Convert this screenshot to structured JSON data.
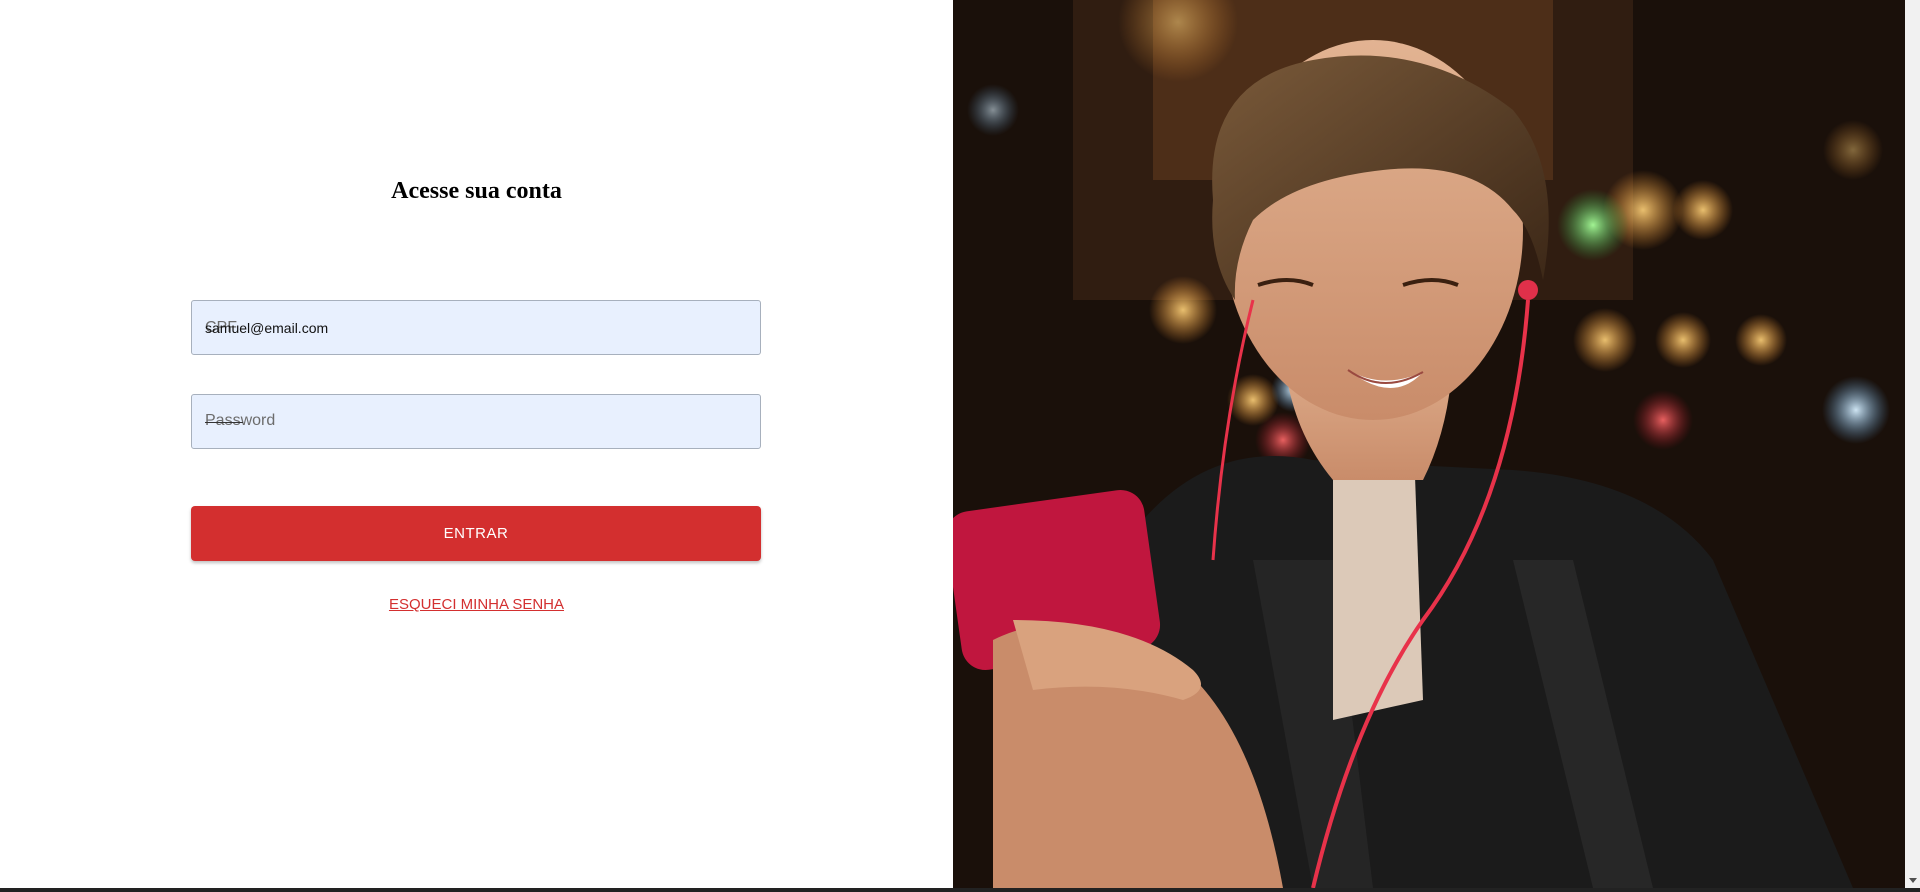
{
  "login": {
    "title": "Acesse sua conta",
    "cpf_placeholder": "CPF",
    "cpf_value": "samuel@email.com",
    "password_placeholder": "Password",
    "enter_label": "ENTRAR",
    "forgot_label": "ESQUECI MINHA SENHA"
  },
  "hero": {
    "description": "Woman with short hair wearing red earphones and black leather jacket looking at a red smartphone at night with city bokeh lights"
  },
  "colors": {
    "accent": "#d32f2f",
    "field_bg": "#e8f0fe"
  }
}
